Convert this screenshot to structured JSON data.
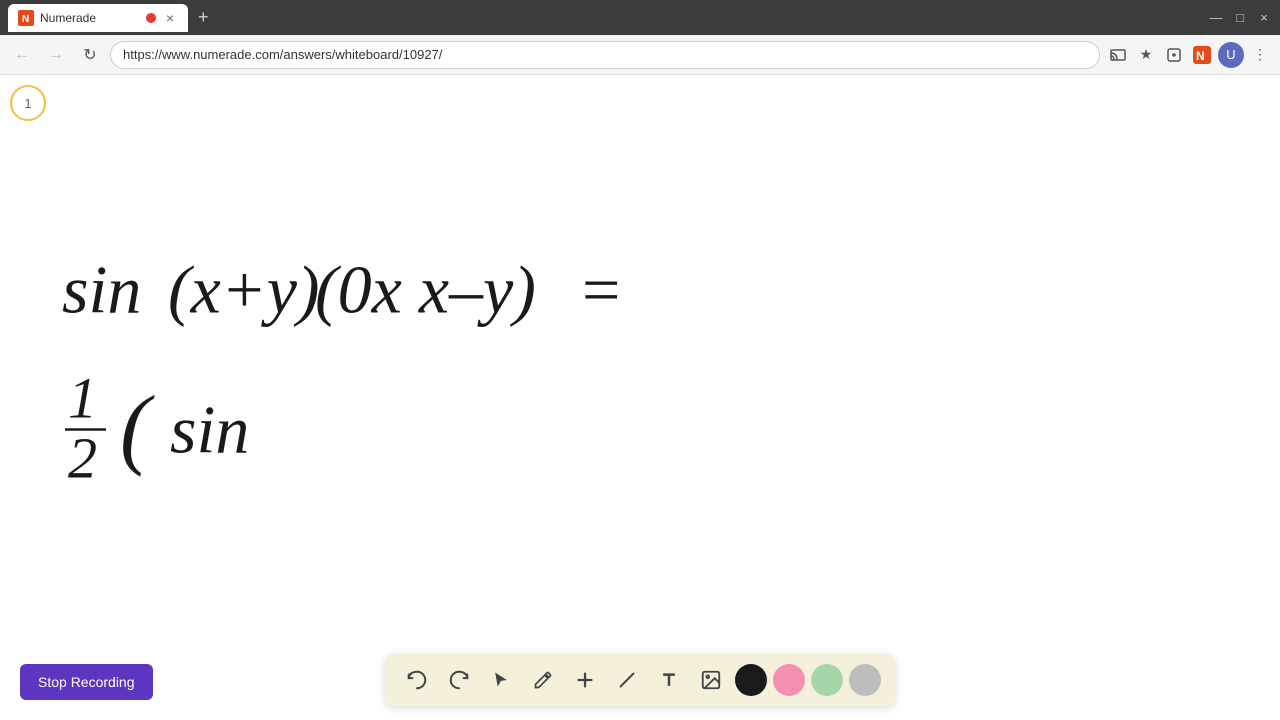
{
  "browser": {
    "tab": {
      "favicon": "N",
      "title": "Numerade",
      "recording_dot": true,
      "close": "×"
    },
    "new_tab": "+",
    "window_controls": {
      "minimize": "—",
      "maximize": "□",
      "close": "×"
    },
    "nav": {
      "back": "←",
      "forward": "→",
      "refresh": "↻",
      "url": "https://www.numerade.com/answers/whiteboard/10927/"
    }
  },
  "whiteboard": {
    "page_number": "1",
    "math_lines": [
      "sin(x+y)(0x x-y) =",
      "1/2 ( sin"
    ]
  },
  "toolbar": {
    "undo_label": "↩",
    "redo_label": "↪",
    "select_label": "↖",
    "pen_label": "✏",
    "plus_label": "+",
    "eraser_label": "/",
    "text_label": "A",
    "image_label": "🖼",
    "colors": [
      "#1a1a1a",
      "#f48fb1",
      "#a5d6a7",
      "#bdbdbd"
    ]
  },
  "stop_recording": {
    "label": "Stop Recording"
  }
}
